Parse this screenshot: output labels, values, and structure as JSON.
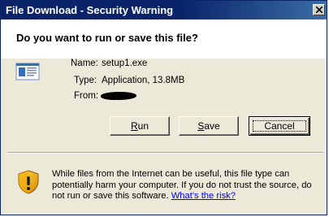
{
  "window": {
    "title": "File Download - Security Warning"
  },
  "question": "Do you want to run or save this file?",
  "file": {
    "name_label": "Name:",
    "name_value": "setup1.exe",
    "type_label": "Type:",
    "type_value": "Application, 13.8MB",
    "from_label": "From:"
  },
  "buttons": {
    "run_label": "Run",
    "run_mnemonic": "R",
    "run_rest": "un",
    "save_label": "Save",
    "save_mnemonic": "S",
    "save_rest": "ave",
    "cancel_label": "Cancel"
  },
  "warning": {
    "text": "While files from the Internet can be useful, this file type can potentially harm your computer. If you do not trust the source, do not run or save this software. ",
    "link_text": "What's the risk?"
  },
  "icons": {
    "close": "close-icon",
    "file": "application-file-icon",
    "shield": "security-shield-icon"
  },
  "colors": {
    "title_bar": "#0a246a",
    "dialog_bg": "#ece9d8",
    "link": "#0000ff"
  }
}
